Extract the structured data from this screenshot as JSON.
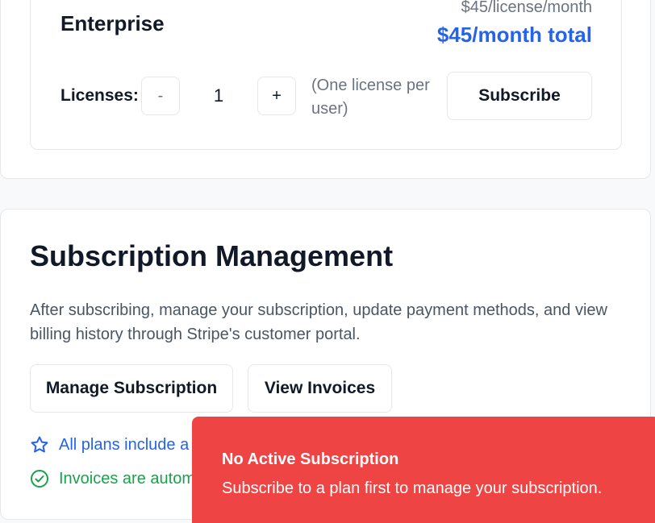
{
  "plan": {
    "name": "Enterprise",
    "unit_price": "$45/license/month",
    "total": "$45/month total",
    "licenses_label": "Licenses:",
    "minus_label": "-",
    "plus_label": "+",
    "quantity": "1",
    "license_note": "(One license per user)",
    "subscribe_label": "Subscribe"
  },
  "management": {
    "title": "Subscription Management",
    "description": "After subscribing, manage your subscription, update payment methods, and view billing history through Stripe's customer portal.",
    "manage_label": "Manage Subscription",
    "invoices_label": "View Invoices",
    "features": [
      {
        "icon": "star-icon",
        "text": "All plans include a",
        "color": "#2563eb"
      },
      {
        "icon": "check-circle-icon",
        "text": "Invoices are autom",
        "color": "#16a34a"
      }
    ]
  },
  "toast": {
    "title": "No Active Subscription",
    "description": "Subscribe to a plan first to manage your subscription.",
    "color": "#ef4444"
  }
}
